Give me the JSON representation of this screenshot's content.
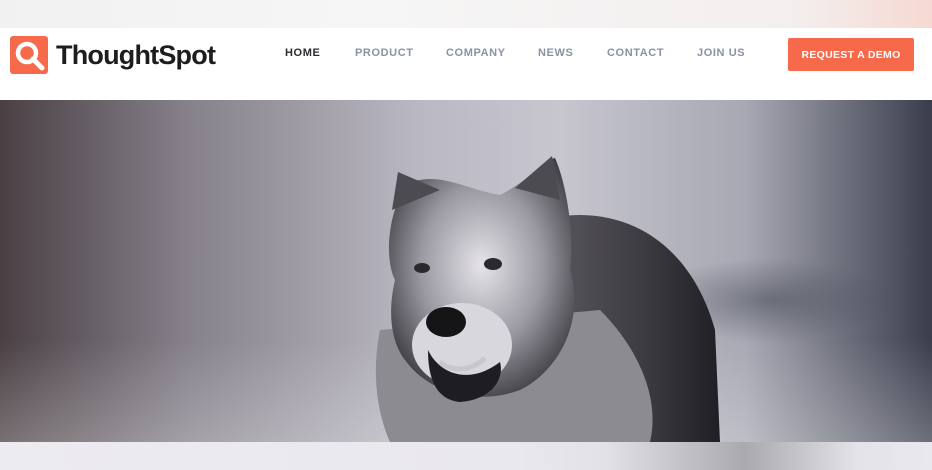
{
  "brand": {
    "name": "ThoughtSpot",
    "accent_color": "#f6694a",
    "logo_icon": "magnifier-logo-icon"
  },
  "nav": {
    "items": [
      {
        "label": "HOME",
        "active": true
      },
      {
        "label": "PRODUCT",
        "active": false
      },
      {
        "label": "COMPANY",
        "active": false
      },
      {
        "label": "NEWS",
        "active": false
      },
      {
        "label": "CONTACT",
        "active": false
      },
      {
        "label": "JOIN US",
        "active": false
      }
    ],
    "cta_label": "REQUEST A DEMO"
  },
  "hero": {
    "image": "wolf-photo"
  }
}
